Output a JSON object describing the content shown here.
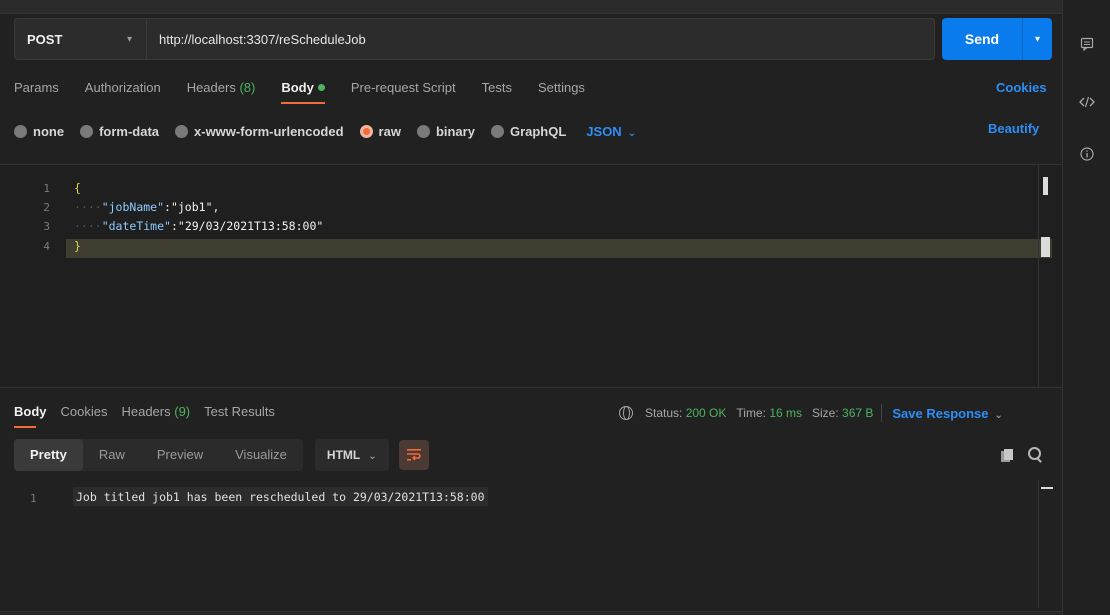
{
  "request": {
    "method": "POST",
    "url": "http://localhost:3307/reScheduleJob",
    "send_label": "Send"
  },
  "request_tabs": [
    {
      "label": "Params"
    },
    {
      "label": "Authorization"
    },
    {
      "label": "Headers",
      "count": "(8)"
    },
    {
      "label": "Body"
    },
    {
      "label": "Pre-request Script"
    },
    {
      "label": "Tests"
    },
    {
      "label": "Settings"
    }
  ],
  "cookies_label": "Cookies",
  "body_types": [
    {
      "label": "none"
    },
    {
      "label": "form-data"
    },
    {
      "label": "x-www-form-urlencoded"
    },
    {
      "label": "raw"
    },
    {
      "label": "binary"
    },
    {
      "label": "GraphQL"
    }
  ],
  "raw_format": "JSON",
  "beautify_label": "Beautify",
  "editor": {
    "line_numbers": [
      "1",
      "2",
      "3",
      "4"
    ],
    "lines": {
      "open": "{",
      "dots": "····",
      "k1": "\"jobName\"",
      "v1": "\"job1\"",
      "k2": "\"dateTime\"",
      "v2": "\"29/03/2021T13:58:00\"",
      "close": "}"
    }
  },
  "response_tabs": [
    {
      "label": "Body"
    },
    {
      "label": "Cookies"
    },
    {
      "label": "Headers",
      "count": "(9)"
    },
    {
      "label": "Test Results"
    }
  ],
  "status": {
    "status_label": "Status:",
    "status_value": "200 OK",
    "time_label": "Time:",
    "time_value": "16 ms",
    "size_label": "Size:",
    "size_value": "367 B"
  },
  "save_response_label": "Save Response",
  "view_modes": [
    "Pretty",
    "Raw",
    "Preview",
    "Visualize"
  ],
  "response_format": "HTML",
  "response": {
    "line_number": "1",
    "text": "Job titled job1 has been rescheduled to 29/03/2021T13:58:00"
  },
  "colors": {
    "accent": "#097bed",
    "active_tab_underline": "#f26b3a",
    "ok": "#4cb35f"
  },
  "icons": [
    "comment-icon",
    "code-icon",
    "info-icon",
    "globe-icon",
    "wrap-lines-icon",
    "copy-icon",
    "search-icon"
  ]
}
